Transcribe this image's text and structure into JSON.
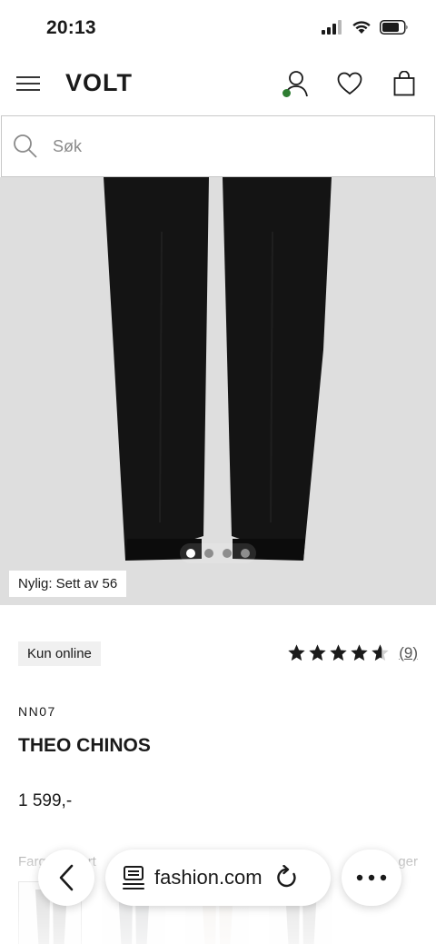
{
  "status_bar": {
    "time": "20:13",
    "icons": [
      "cellular-signal-icon",
      "wifi-icon",
      "battery-icon"
    ]
  },
  "header": {
    "logo": "VOLT",
    "icons": [
      "menu-icon",
      "account-icon",
      "wishlist-heart-icon",
      "shopping-bag-icon"
    ],
    "account_status_color": "#2e7d32"
  },
  "search": {
    "placeholder": "Søk",
    "value": ""
  },
  "gallery": {
    "image_count": 4,
    "active_index": 0,
    "recent_views": "Nylig: Sett av 56",
    "background_color": "#dedede"
  },
  "product": {
    "badge": "Kun online",
    "rating": {
      "stars": 4.5,
      "max": 5,
      "count_label": "(9)"
    },
    "brand": "NN07",
    "name": "THEO CHINOS",
    "price": "1 599,-",
    "color_label": "Farg",
    "color_label_tail": "rt",
    "variants_label_tail": "ger"
  },
  "browser": {
    "url": "fashion.com",
    "icons": [
      "back-chevron-icon",
      "reader-mode-icon",
      "reload-icon",
      "more-dots-icon"
    ]
  }
}
